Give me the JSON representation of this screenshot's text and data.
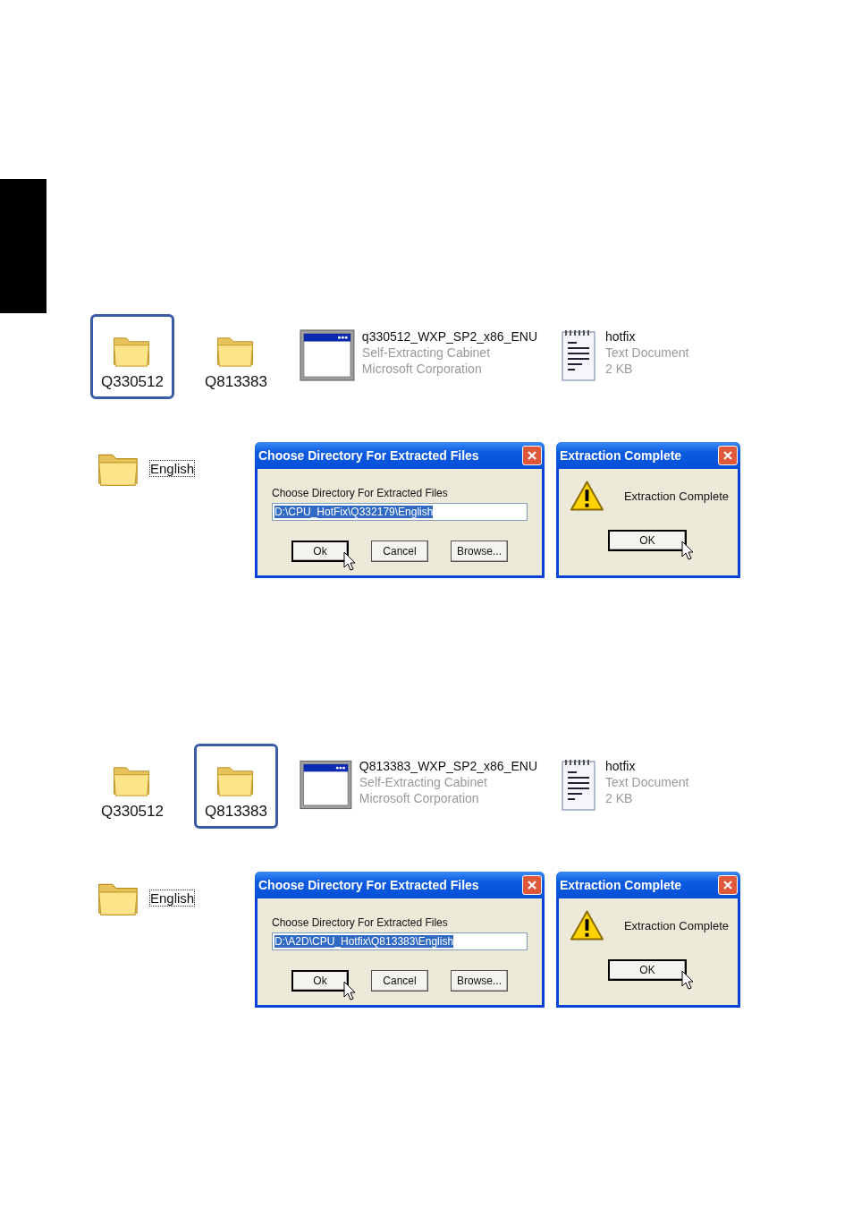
{
  "sections": [
    {
      "files": [
        {
          "kind": "folder",
          "name": "Q330512",
          "selected": true
        },
        {
          "kind": "folder",
          "name": "Q813383",
          "selected": false
        },
        {
          "kind": "installer",
          "name": "q330512_WXP_SP2_x86_ENU",
          "type": "Self-Extracting Cabinet",
          "detail": "Microsoft Corporation",
          "selected": false
        },
        {
          "kind": "text_document",
          "name": "hotfix",
          "type": "Text Document",
          "detail": "2 KB",
          "selected": false
        }
      ],
      "subfolder": {
        "name": "English",
        "focused": true
      },
      "choose_dialog": {
        "title": "Choose Directory For Extracted Files",
        "label": "Choose Directory For Extracted Files",
        "path": "D:\\CPU_HotFix\\Q332179\\English",
        "path_selected": true,
        "buttons": [
          {
            "label": "Ok",
            "default": true,
            "pointed": true
          },
          {
            "label": "Cancel",
            "default": false,
            "pointed": false
          },
          {
            "label": "Browse...",
            "default": false,
            "pointed": false
          }
        ]
      },
      "complete_dialog": {
        "title": "Extraction Complete",
        "message": "Extraction Complete",
        "button": {
          "label": "OK",
          "default": true,
          "pointed": true
        }
      }
    },
    {
      "files": [
        {
          "kind": "folder",
          "name": "Q330512",
          "selected": false
        },
        {
          "kind": "folder",
          "name": "Q813383",
          "selected": true
        },
        {
          "kind": "installer",
          "name": "Q813383_WXP_SP2_x86_ENU",
          "type": "Self-Extracting Cabinet",
          "detail": "Microsoft Corporation",
          "selected": false
        },
        {
          "kind": "text_document",
          "name": "hotfix",
          "type": "Text Document",
          "detail": "2 KB",
          "selected": false
        }
      ],
      "subfolder": {
        "name": "English",
        "focused": true
      },
      "choose_dialog": {
        "title": "Choose Directory For Extracted Files",
        "label": "Choose Directory For Extracted Files",
        "path": "D:\\A2D\\CPU_Hotfix\\Q813383\\English",
        "path_selected": true,
        "buttons": [
          {
            "label": "Ok",
            "default": true,
            "pointed": true
          },
          {
            "label": "Cancel",
            "default": false,
            "pointed": false
          },
          {
            "label": "Browse...",
            "default": false,
            "pointed": false
          }
        ]
      },
      "complete_dialog": {
        "title": "Extraction Complete",
        "message": "Extraction Complete",
        "button": {
          "label": "OK",
          "default": true,
          "pointed": true
        }
      }
    }
  ]
}
